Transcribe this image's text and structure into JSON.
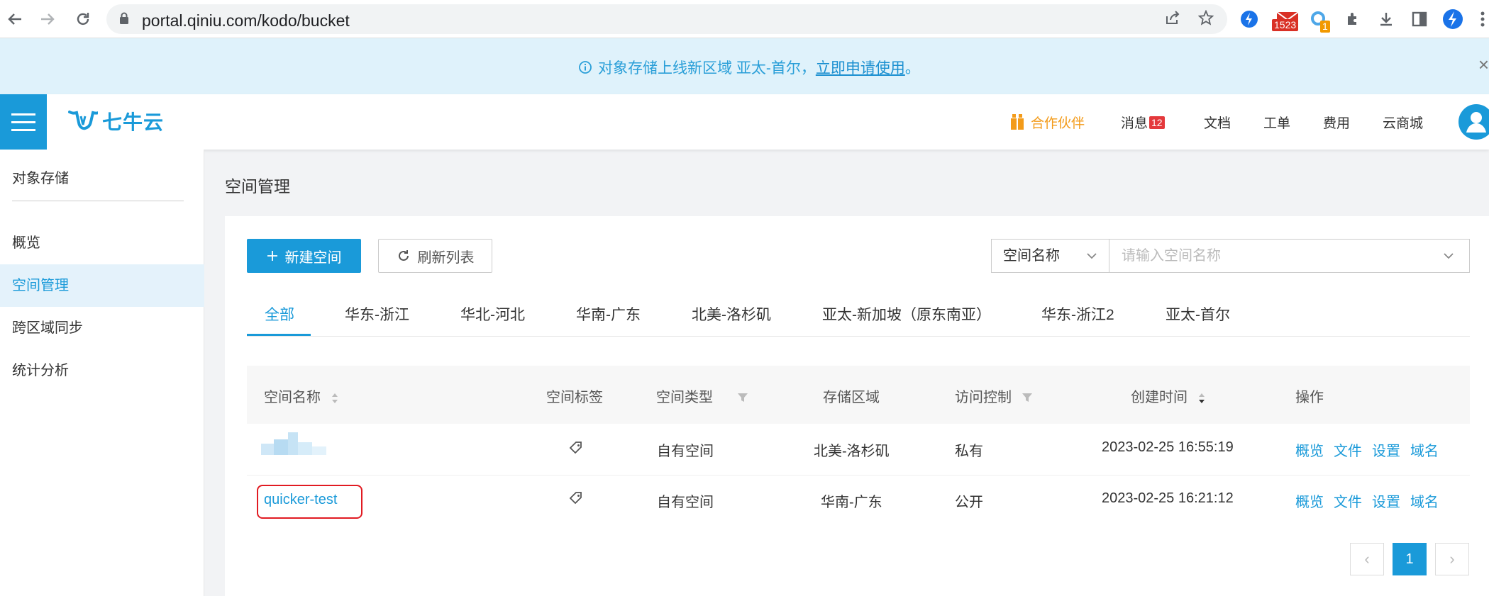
{
  "browser": {
    "url": "portal.qiniu.com/kodo/bucket",
    "ext_mail_badge": "1523",
    "ext_badge_2": "1"
  },
  "notice": {
    "text": "对象存储上线新区域 亚太-首尔，",
    "link": "立即申请使用",
    "tail": "。"
  },
  "topbar": {
    "logo": "七牛云",
    "partner": "合作伙伴",
    "messages": "消息",
    "messages_count": "12",
    "docs": "文档",
    "tickets": "工单",
    "billing": "费用",
    "store": "云商城"
  },
  "sidebar": {
    "header": "对象存储",
    "items": [
      {
        "label": "概览"
      },
      {
        "label": "空间管理"
      },
      {
        "label": "跨区域同步"
      },
      {
        "label": "统计分析"
      }
    ]
  },
  "main": {
    "title": "空间管理",
    "new_bucket": "新建空间",
    "refresh": "刷新列表",
    "search_field": "空间名称",
    "search_placeholder": "请输入空间名称",
    "tabs": [
      "全部",
      "华东-浙江",
      "华北-河北",
      "华南-广东",
      "北美-洛杉矶",
      "亚太-新加坡（原东南亚）",
      "华东-浙江2",
      "亚太-首尔"
    ],
    "columns": [
      "空间名称",
      "空间标签",
      "空间类型",
      "存储区域",
      "访问控制",
      "创建时间",
      "操作"
    ],
    "rows": [
      {
        "name": "",
        "type": "自有空间",
        "region": "北美-洛杉矶",
        "access": "私有",
        "created": "2023-02-25 16:55:19",
        "actions": [
          "概览",
          "文件",
          "设置",
          "域名"
        ]
      },
      {
        "name": "quicker-test",
        "type": "自有空间",
        "region": "华南-广东",
        "access": "公开",
        "created": "2023-02-25 16:21:12",
        "actions": [
          "概览",
          "文件",
          "设置",
          "域名"
        ]
      }
    ],
    "pager": {
      "prev": "‹",
      "current": "1",
      "next": "›"
    }
  }
}
